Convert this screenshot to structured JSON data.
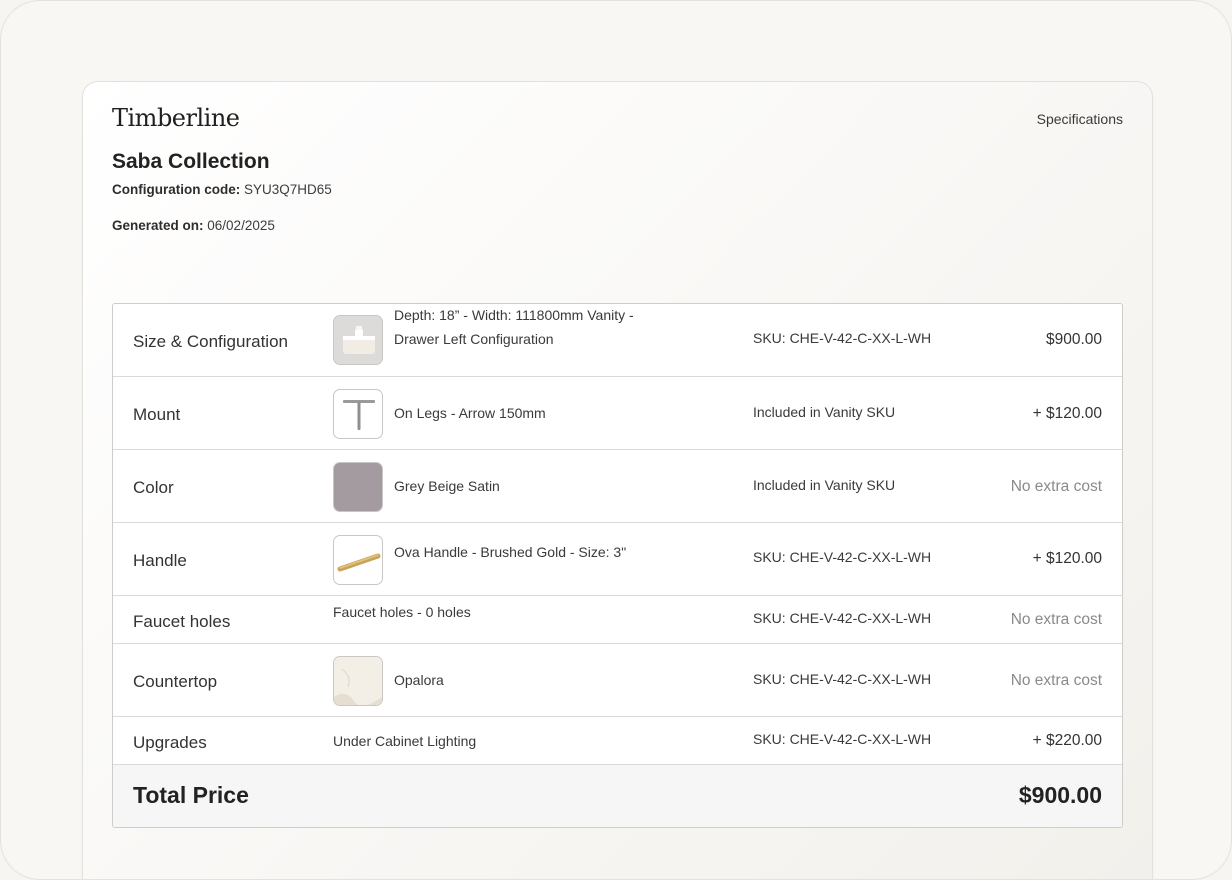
{
  "header": {
    "brand": "Timberline",
    "specifications_link": "Specifications",
    "collection": "Saba Collection",
    "configuration_code_label": "Configuration code:",
    "configuration_code": "SYU3Q7HD65",
    "generated_on_label": "Generated on:",
    "generated_on": "06/02/2025"
  },
  "rows": [
    {
      "category": "Size & Configuration",
      "thumbnail": "vanity-thumbnail",
      "description": "Depth: 18” - Width: 111800mm Vanity - Drawer Left Configuration",
      "sku": "SKU: CHE-V-42-C-XX-L-WH",
      "price": "$900.00"
    },
    {
      "category": "Mount",
      "thumbnail": "legs-thumbnail",
      "description": "On Legs - Arrow 150mm",
      "sku": "Included in Vanity SKU",
      "price": "+ $120.00"
    },
    {
      "category": "Color",
      "thumbnail": "color-swatch",
      "swatch_color": "#a39ba0",
      "description": "Grey Beige Satin",
      "sku": "Included in Vanity SKU",
      "price": "No extra cost"
    },
    {
      "category": "Handle",
      "thumbnail": "handle-thumbnail",
      "description": "Ova Handle - Brushed Gold - Size: 3\"",
      "sku": "SKU: CHE-V-42-C-XX-L-WH",
      "price": "+ $120.00"
    },
    {
      "category": "Faucet holes",
      "description": "Faucet holes - 0 holes",
      "sku": "SKU: CHE-V-42-C-XX-L-WH",
      "price": "No extra cost"
    },
    {
      "category": "Countertop",
      "thumbnail": "countertop-thumbnail",
      "description": "Opalora",
      "sku": "SKU: CHE-V-42-C-XX-L-WH",
      "price": "No extra cost"
    },
    {
      "category": "Upgrades",
      "description": "Under Cabinet Lighting",
      "sku": "SKU: CHE-V-42-C-XX-L-WH",
      "price": "+ $220.00"
    }
  ],
  "total": {
    "label": "Total Price",
    "amount": "$900.00"
  }
}
